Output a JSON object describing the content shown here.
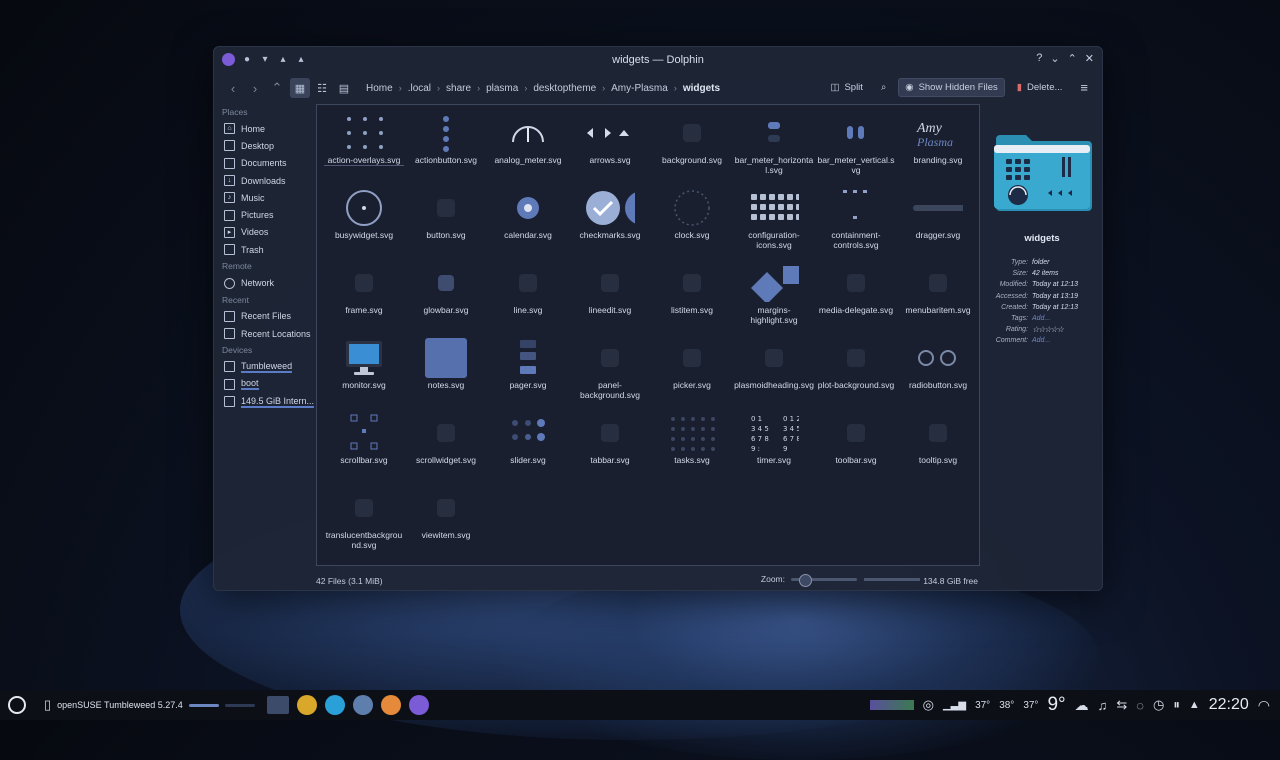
{
  "window": {
    "title": "widgets — Dolphin"
  },
  "toolbar": {
    "split_label": "Split",
    "hidden_label": "Show Hidden Files",
    "delete_label": "Delete...",
    "breadcrumb": [
      "Home",
      ".local",
      "share",
      "plasma",
      "desktoptheme",
      "Amy-Plasma",
      "widgets"
    ]
  },
  "sidebar": {
    "places_title": "Places",
    "places": [
      "Home",
      "Desktop",
      "Documents",
      "Downloads",
      "Music",
      "Pictures",
      "Videos",
      "Trash"
    ],
    "remote_title": "Remote",
    "remote": [
      "Network"
    ],
    "recent_title": "Recent",
    "recent": [
      "Recent Files",
      "Recent Locations"
    ],
    "devices_title": "Devices",
    "devices": [
      "Tumbleweed",
      "boot",
      "149.5 GiB Intern..."
    ]
  },
  "files": [
    "action-overlays.svg",
    "actionbutton.svg",
    "analog_meter.svg",
    "arrows.svg",
    "background.svg",
    "bar_meter_horizontal.svg",
    "bar_meter_vertical.svg",
    "branding.svg",
    "busywidget.svg",
    "button.svg",
    "calendar.svg",
    "checkmarks.svg",
    "clock.svg",
    "configuration-icons.svg",
    "containment-controls.svg",
    "dragger.svg",
    "frame.svg",
    "glowbar.svg",
    "line.svg",
    "lineedit.svg",
    "listitem.svg",
    "margins-highlight.svg",
    "media-delegate.svg",
    "menubaritem.svg",
    "monitor.svg",
    "notes.svg",
    "pager.svg",
    "panel-background.svg",
    "picker.svg",
    "plasmoidheading.svg",
    "plot-background.svg",
    "radiobutton.svg",
    "scrollbar.svg",
    "scrollwidget.svg",
    "slider.svg",
    "tabbar.svg",
    "tasks.svg",
    "timer.svg",
    "toolbar.svg",
    "tooltip.svg",
    "translucentbackground.svg",
    "viewitem.svg"
  ],
  "status": {
    "count": "42 Files (3.1 MiB)",
    "zoom_label": "Zoom:",
    "free": "134.8 GiB free"
  },
  "info": {
    "name": "widgets",
    "rows": [
      {
        "k": "Type:",
        "v": "folder"
      },
      {
        "k": "Size:",
        "v": "42 items"
      },
      {
        "k": "Modified:",
        "v": "Today at 12:13"
      },
      {
        "k": "Accessed:",
        "v": "Today at 13:19"
      },
      {
        "k": "Created:",
        "v": "Today at 12:13"
      },
      {
        "k": "Tags:",
        "v": "Add..."
      },
      {
        "k": "Rating:",
        "v": "☆☆☆☆☆"
      },
      {
        "k": "Comment:",
        "v": "Add..."
      }
    ]
  },
  "panel": {
    "task_label": "openSUSE Tumbleweed 5.27.4",
    "temps": [
      "37°",
      "38°",
      "37°"
    ],
    "weather": "9°",
    "clock": "22:20"
  },
  "colors": {
    "accent": "#5b7bc6",
    "window_bg": "#1e2536",
    "purple_icon": "#7b5bd6"
  }
}
